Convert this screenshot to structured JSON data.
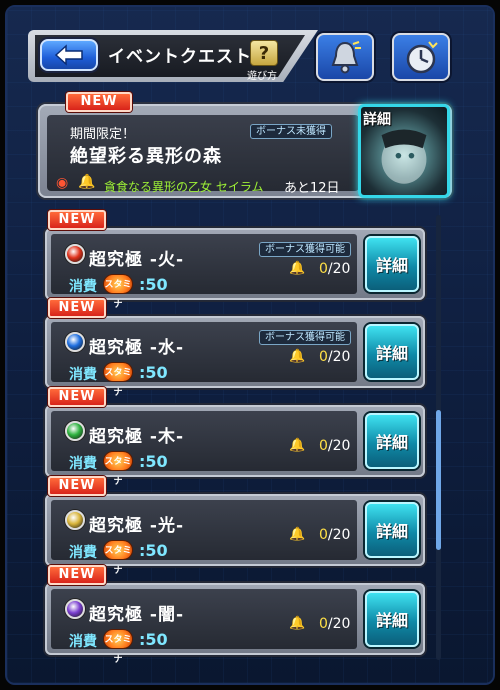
{
  "header": {
    "title": "イベントクエスト",
    "help_symbol": "?",
    "help_label": "遊び方",
    "back_icon": "back-arrow-icon",
    "bell_icon": "bell-icon",
    "clock_icon": "clock-icon"
  },
  "featured": {
    "new_label": "NEW",
    "period": "期間限定！",
    "title": "絶望彩る異形の森",
    "bonus_status": "ボーナス未獲得",
    "boss_name": "貪食なる異形の乙女 セイラム",
    "remaining": "あと12日",
    "detail_label": "詳細"
  },
  "quests": [
    {
      "new_label": "NEW",
      "title": "超究極 -火-",
      "element": "fire",
      "element_color": "#e0321c",
      "bonus": "ボーナス獲得可能",
      "count": "0",
      "max": "/20",
      "cost_label": "消費",
      "stamina_label": "スタミナ",
      "cost_value": ":50",
      "detail_label": "詳細"
    },
    {
      "new_label": "NEW",
      "title": "超究極 -水-",
      "element": "water",
      "element_color": "#1f6fe0",
      "bonus": "ボーナス獲得可能",
      "count": "0",
      "max": "/20",
      "cost_label": "消費",
      "stamina_label": "スタミナ",
      "cost_value": ":50",
      "detail_label": "詳細"
    },
    {
      "new_label": "NEW",
      "title": "超究極 -木-",
      "element": "wood",
      "element_color": "#2fb340",
      "bonus": "",
      "count": "0",
      "max": "/20",
      "cost_label": "消費",
      "stamina_label": "スタミナ",
      "cost_value": ":50",
      "detail_label": "詳細"
    },
    {
      "new_label": "NEW",
      "title": "超究極 -光-",
      "element": "light",
      "element_color": "#d8b43a",
      "bonus": "",
      "count": "0",
      "max": "/20",
      "cost_label": "消費",
      "stamina_label": "スタミナ",
      "cost_value": ":50",
      "detail_label": "詳細"
    },
    {
      "new_label": "NEW",
      "title": "超究極 -闇-",
      "element": "dark",
      "element_color": "#7b3fd0",
      "bonus": "",
      "count": "0",
      "max": "/20",
      "cost_label": "消費",
      "stamina_label": "スタミナ",
      "cost_value": ":50",
      "detail_label": "詳細"
    }
  ]
}
